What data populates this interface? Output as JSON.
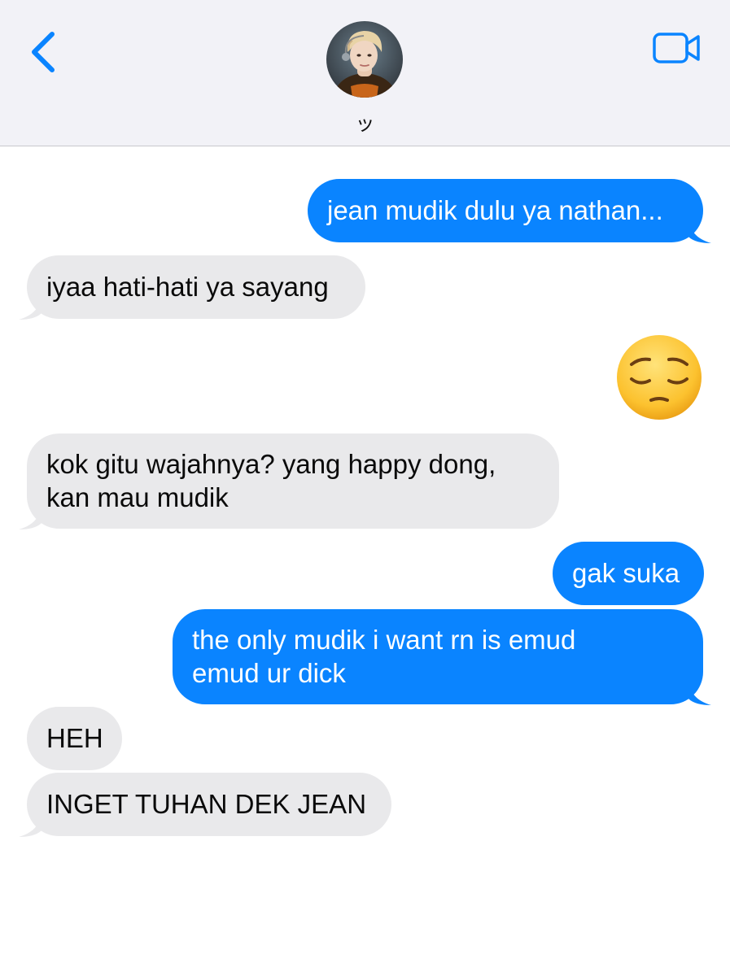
{
  "contact": {
    "name": "ッ"
  },
  "icons": {
    "back": "chevron-left-icon",
    "video": "video-camera-icon",
    "emoji": "pensive-face-emoji"
  },
  "colors": {
    "sent_bubble": "#0a84ff",
    "received_bubble": "#e9e9eb",
    "accent": "#0a84ff",
    "header_bg": "#f2f2f7"
  },
  "messages": [
    {
      "sender": "me",
      "lines": [
        "jean mudik dulu ya nathan..."
      ]
    },
    {
      "sender": "them",
      "lines": [
        "iyaa hati-hati ya sayang"
      ]
    },
    {
      "sender": "me",
      "type": "emoji",
      "emoji": "😔"
    },
    {
      "sender": "them",
      "lines": [
        "kok gitu wajahnya? yang happy dong,",
        "kan mau mudik"
      ]
    },
    {
      "sender": "me",
      "lines": [
        "gak suka"
      ]
    },
    {
      "sender": "me",
      "lines": [
        "the only mudik i want rn is emud",
        "emud ur dick"
      ]
    },
    {
      "sender": "them",
      "lines": [
        "HEH"
      ]
    },
    {
      "sender": "them",
      "lines": [
        "INGET TUHAN DEK JEAN"
      ]
    }
  ]
}
